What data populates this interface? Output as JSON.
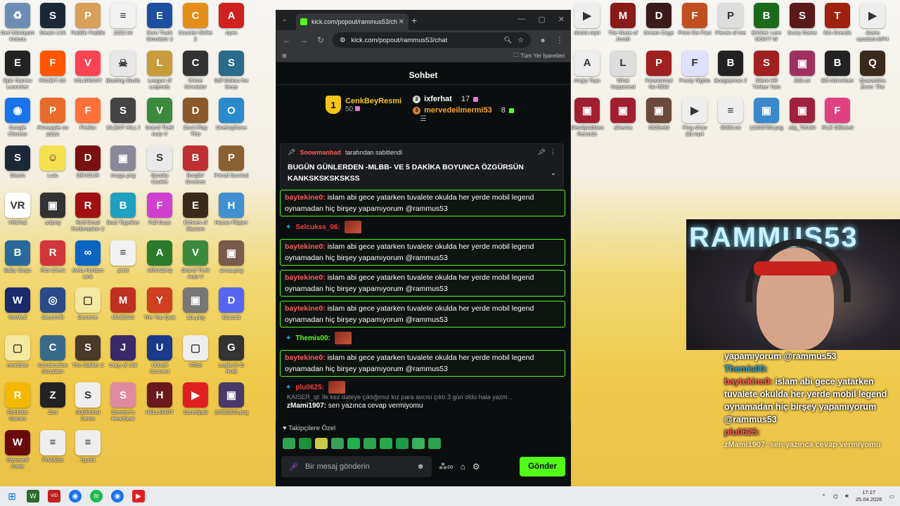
{
  "browser": {
    "tab_title": "kick.com/popout/rammus53/ch",
    "url": "kick.com/popout/rammus53/chat",
    "bookmarks_label": "Tüm Yer İşaretleri"
  },
  "chat": {
    "header": "Sohbet",
    "leaderboard": {
      "first": {
        "name": "CenkBeyResmi",
        "count": "50",
        "rank": "1"
      },
      "others": [
        {
          "rank": "2",
          "name": "ixferhat",
          "count": "17",
          "color": "#ffffff"
        },
        {
          "rank": "3",
          "name": "mervedeilmermi53",
          "count": "8",
          "color": "#f5a623"
        }
      ]
    },
    "pinned": {
      "by": "Snowmanhad",
      "by_suffix": "tarafından sabitlendi",
      "message": "BUGÜN GÜNLERDEN -MLBB- VE 5 DAKİKA BOYUNCA ÖZGÜRSÜN KANKSKSKSKSKSS"
    },
    "messages": [
      {
        "user": "baytekine0:",
        "color": "#ff5a5a",
        "text": " islam abi gece yatarken tuvalete okulda her yerde mobil legend oynamadan hiç birşey yapamıyorum @rammus53",
        "highlight": true
      },
      {
        "user": "Selcukss_06:",
        "color": "#ff3b3b",
        "text": "",
        "highlight": false,
        "emote": true
      },
      {
        "user": "baytekine0:",
        "color": "#ff5a5a",
        "text": " islam abi gece yatarken tuvalete okulda her yerde mobil legend oynamadan hiç birşey yapamıyorum @rammus53",
        "highlight": true
      },
      {
        "user": "baytekine0:",
        "color": "#ff5a5a",
        "text": " islam abi gece yatarken tuvalete okulda her yerde mobil legend oynamadan hiç birşey yapamıyorum @rammus53",
        "highlight": true
      },
      {
        "user": "baytekine0:",
        "color": "#ff5a5a",
        "text": " islam abi gece yatarken tuvalete okulda her yerde mobil legend oynamadan hiç birşey yapamıyorum @rammus53",
        "highlight": true
      },
      {
        "user": "Themis00:",
        "color": "#53fc18",
        "text": "",
        "highlight": false,
        "emote": true
      },
      {
        "user": "baytekine0:",
        "color": "#ff5a5a",
        "text": " islam abi gece yatarken tuvalete okulda her yerde mobil legend oynamadan hiç birşey yapamıyorum @rammus53",
        "highlight": true
      },
      {
        "user": "plu0625:",
        "color": "#ff3b3b",
        "text": "",
        "highlight": false,
        "emote": true
      }
    ],
    "grey_line": "KAISER_ql: İlk kez dateye çıktığımız kız para avcısı çıktı 3 gün oldu hala yazm...",
    "last_user": "zMami1907:",
    "last_text": " sen yazınca cevap vermiyomu",
    "sub_only": "Takipçilere Özel",
    "input_placeholder": "Bir mesaj gönderin",
    "send_label": "Gönder"
  },
  "overlay": {
    "line1": "yapamıyorum @rammus53",
    "user1": "Themis00:",
    "user2": "baytekine0:",
    "text2": " islam abi gece yatarken tuvalete okulda her yerde mobil legend oynamadan hiç birşey yapamıyorum @rammus53",
    "user3": "plu0625:",
    "faint": "zMami1907: sen yazınca cevap vermiyomu",
    "cam_brand": "RAMMUS53"
  },
  "taskbar": {
    "time": "17:27",
    "date": "25.04.2026"
  },
  "desktop_icons": [
    {
      "label": "Geri Dönüşüm Kutusu",
      "c": "#6b8db5",
      "g": "♻"
    },
    {
      "label": "Steam Link",
      "c": "#1b2838",
      "g": "S"
    },
    {
      "label": "Paddle Paddle",
      "c": "#d9a05a",
      "g": "P"
    },
    {
      "label": "2222.txt",
      "c": "#f2f2f2",
      "g": "≡"
    },
    {
      "label": "Euro Truck Simulator 2",
      "c": "#1d4fa0",
      "g": "E"
    },
    {
      "label": "Counter-Strike 2",
      "c": "#e38f1a",
      "g": "C"
    },
    {
      "label": "Apex",
      "c": "#d02020",
      "g": "A"
    },
    {
      "label": "Epic Games Launcher",
      "c": "#222",
      "g": "E"
    },
    {
      "label": "FACEIT AC",
      "c": "#ff5500",
      "g": "F"
    },
    {
      "label": "VALORANT",
      "c": "#fa4454",
      "g": "V"
    },
    {
      "label": "Blasting Skulls",
      "c": "#e7e7e7",
      "g": "☠"
    },
    {
      "label": "League of Legends",
      "c": "#c89b3c",
      "g": "L"
    },
    {
      "label": "Crime Simulator",
      "c": "#333",
      "g": "C"
    },
    {
      "label": "Still Wakes the Deep",
      "c": "#2a6a8a",
      "g": "S"
    },
    {
      "label": "Google Chrome",
      "c": "#1a73e8",
      "g": "◉"
    },
    {
      "label": "Pineapple on pizza",
      "c": "#e96b2a",
      "g": "P"
    },
    {
      "label": "Firefox",
      "c": "#ff7139",
      "g": "F"
    },
    {
      "label": "SILENT HILL f",
      "c": "#444",
      "g": "S"
    },
    {
      "label": "Grand Theft Auto V",
      "c": "#3c8b3c",
      "g": "V"
    },
    {
      "label": "Don't Play This",
      "c": "#8a5a2b",
      "g": "D"
    },
    {
      "label": "Onetrophone",
      "c": "#2a8acb",
      "g": "O"
    },
    {
      "label": "Steam",
      "c": "#1b2838",
      "g": "S"
    },
    {
      "label": "Luto",
      "c": "#f5e050",
      "g": "☺"
    },
    {
      "label": "DEVOUR",
      "c": "#7a1010",
      "g": "D"
    },
    {
      "label": "image.png",
      "c": "#889",
      "g": "▣"
    },
    {
      "label": "Spooky Cookie",
      "c": "#e9e9e9",
      "g": "S"
    },
    {
      "label": "Burglin' Gnomes",
      "c": "#c03030",
      "g": "B"
    },
    {
      "label": "Primal Survival",
      "c": "#8a6030",
      "g": "P"
    },
    {
      "label": "VRChat",
      "c": "#fff",
      "g": "VR"
    },
    {
      "label": "asipng",
      "c": "#333",
      "g": "▣"
    },
    {
      "label": "Red Dead Redemption 2",
      "c": "#a01010",
      "g": "R"
    },
    {
      "label": "Boat Together",
      "c": "#20a0c0",
      "g": "B"
    },
    {
      "label": "Fall Guys",
      "c": "#d040d0",
      "g": "F"
    },
    {
      "label": "Echoes of Elysium",
      "c": "#3a2a1a",
      "g": "E"
    },
    {
      "label": "House Flipper",
      "c": "#4090d0",
      "g": "H"
    },
    {
      "label": "Baby Steps",
      "c": "#2a6a9a",
      "g": "B"
    },
    {
      "label": "Riot Client",
      "c": "#d13639",
      "g": "R"
    },
    {
      "label": "Meta Horizon Link",
      "c": "#0a66c2",
      "g": "∞"
    },
    {
      "label": "pi.txt",
      "c": "#f2f2f2",
      "g": "≡"
    },
    {
      "label": "ARKADAŞ",
      "c": "#2a7a2a",
      "g": "A"
    },
    {
      "label": "Grand Theft Auto V",
      "c": "#3c8b3c",
      "g": "V"
    },
    {
      "label": "amaa.png",
      "c": "#7a5a4a",
      "g": "▣"
    },
    {
      "label": "WeMod",
      "c": "#1a2a6a",
      "g": "W"
    },
    {
      "label": "SteamVR",
      "c": "#2a4a8a",
      "g": "◎"
    },
    {
      "label": "Deneme",
      "c": "#f5e8a0",
      "g": "▢"
    },
    {
      "label": "MIMESIS",
      "c": "#c03020",
      "g": "M"
    },
    {
      "label": "The You Quiz",
      "c": "#d04020",
      "g": "Y"
    },
    {
      "label": "111.png",
      "c": "#777",
      "g": "▣"
    },
    {
      "label": "Discord",
      "c": "#5865f2",
      "g": "D"
    },
    {
      "label": "newdone",
      "c": "#f5e8a0",
      "g": "▢"
    },
    {
      "label": "Construction Simulator",
      "c": "#3a6a8a",
      "g": "C"
    },
    {
      "label": "The Stalker 2",
      "c": "#4a3a2a",
      "g": "S"
    },
    {
      "label": "Copy of Jell",
      "c": "#3a2a6a",
      "g": "J"
    },
    {
      "label": "Ubisoft Connect",
      "c": "#1a3a8a",
      "g": "U"
    },
    {
      "label": "VRtoi",
      "c": "#eee",
      "g": "▢"
    },
    {
      "label": "Logitech G HUB",
      "c": "#333",
      "g": "G"
    },
    {
      "label": "Rockstar Games",
      "c": "#f5b800",
      "g": "R"
    },
    {
      "label": "Zort",
      "c": "#222",
      "g": "Z"
    },
    {
      "label": "Subliminal Demo",
      "c": "#eee",
      "g": "S"
    },
    {
      "label": "Summer's Heartbeat",
      "c": "#e08aa0",
      "g": "S"
    },
    {
      "label": "HELLMART",
      "c": "#6a1a1a",
      "g": "H"
    },
    {
      "label": "Soundpad",
      "c": "#e02020",
      "g": "▶"
    },
    {
      "label": "20082825.png",
      "c": "#4a3a6a",
      "g": "▣"
    },
    {
      "label": "Werewolf Party",
      "c": "#6a0a0a",
      "g": "W"
    },
    {
      "label": "PUANlist",
      "c": "#eee",
      "g": "≡"
    },
    {
      "label": "fsprint",
      "c": "#eee",
      "g": "≡"
    }
  ],
  "right_icons": [
    {
      "label": "doctor.mp4",
      "c": "#eee",
      "g": "▶"
    },
    {
      "label": "The Maze of Jonah",
      "c": "#8a1a1a",
      "g": "M"
    },
    {
      "label": "Dream Cage",
      "c": "#3a1a1a",
      "g": "D"
    },
    {
      "label": "From the Past",
      "c": "#c05020",
      "g": "F"
    },
    {
      "label": "Pieces of me",
      "c": "#ddd",
      "g": "P"
    },
    {
      "label": "Bricket: Lore DON'T W",
      "c": "#1a6a1a",
      "g": "B"
    },
    {
      "label": "Scary Game",
      "c": "#5a1a1a",
      "g": "S"
    },
    {
      "label": "thin threads",
      "c": "#a02010",
      "g": "T"
    },
    {
      "label": "4sans aysalam.MP4",
      "c": "#eee",
      "g": "▶"
    },
    {
      "label": "Angry Toys",
      "c": "#eee",
      "g": "A"
    },
    {
      "label": "What Happened",
      "c": "#ddd",
      "g": "L"
    },
    {
      "label": "Paranormal No REM",
      "c": "#a02020",
      "g": "P"
    },
    {
      "label": "Frosty Nights",
      "c": "#e0e0ff",
      "g": "F"
    },
    {
      "label": "Boogeyman 2",
      "c": "#222",
      "g": "B"
    },
    {
      "label": "Silent Hill Türkçe Yam",
      "c": "#a02020",
      "g": "S"
    },
    {
      "label": "333.rar",
      "c": "#a03060",
      "g": "▣"
    },
    {
      "label": "Bill Adventure",
      "c": "#222",
      "g": "B"
    },
    {
      "label": "Quarantine Zone: The",
      "c": "#3a2a1a",
      "g": "Q"
    },
    {
      "label": "Slendytubbies Records",
      "c": "#a02030",
      "g": "▣"
    },
    {
      "label": "silverna",
      "c": "#a02030",
      "g": "▣"
    },
    {
      "label": "6825e9d",
      "c": "#6a4a3a",
      "g": "▣"
    },
    {
      "label": "Ping show (3).mp4",
      "c": "#eee",
      "g": "▶"
    },
    {
      "label": "tikitiki.txt",
      "c": "#eee",
      "g": "≡"
    },
    {
      "label": "12345760.png",
      "c": "#3a8acb",
      "g": "▣"
    },
    {
      "label": "clip_TIKUN",
      "c": "#a02040",
      "g": "▣"
    },
    {
      "label": "FILE DEleted",
      "c": "#e04080",
      "g": "F"
    }
  ]
}
